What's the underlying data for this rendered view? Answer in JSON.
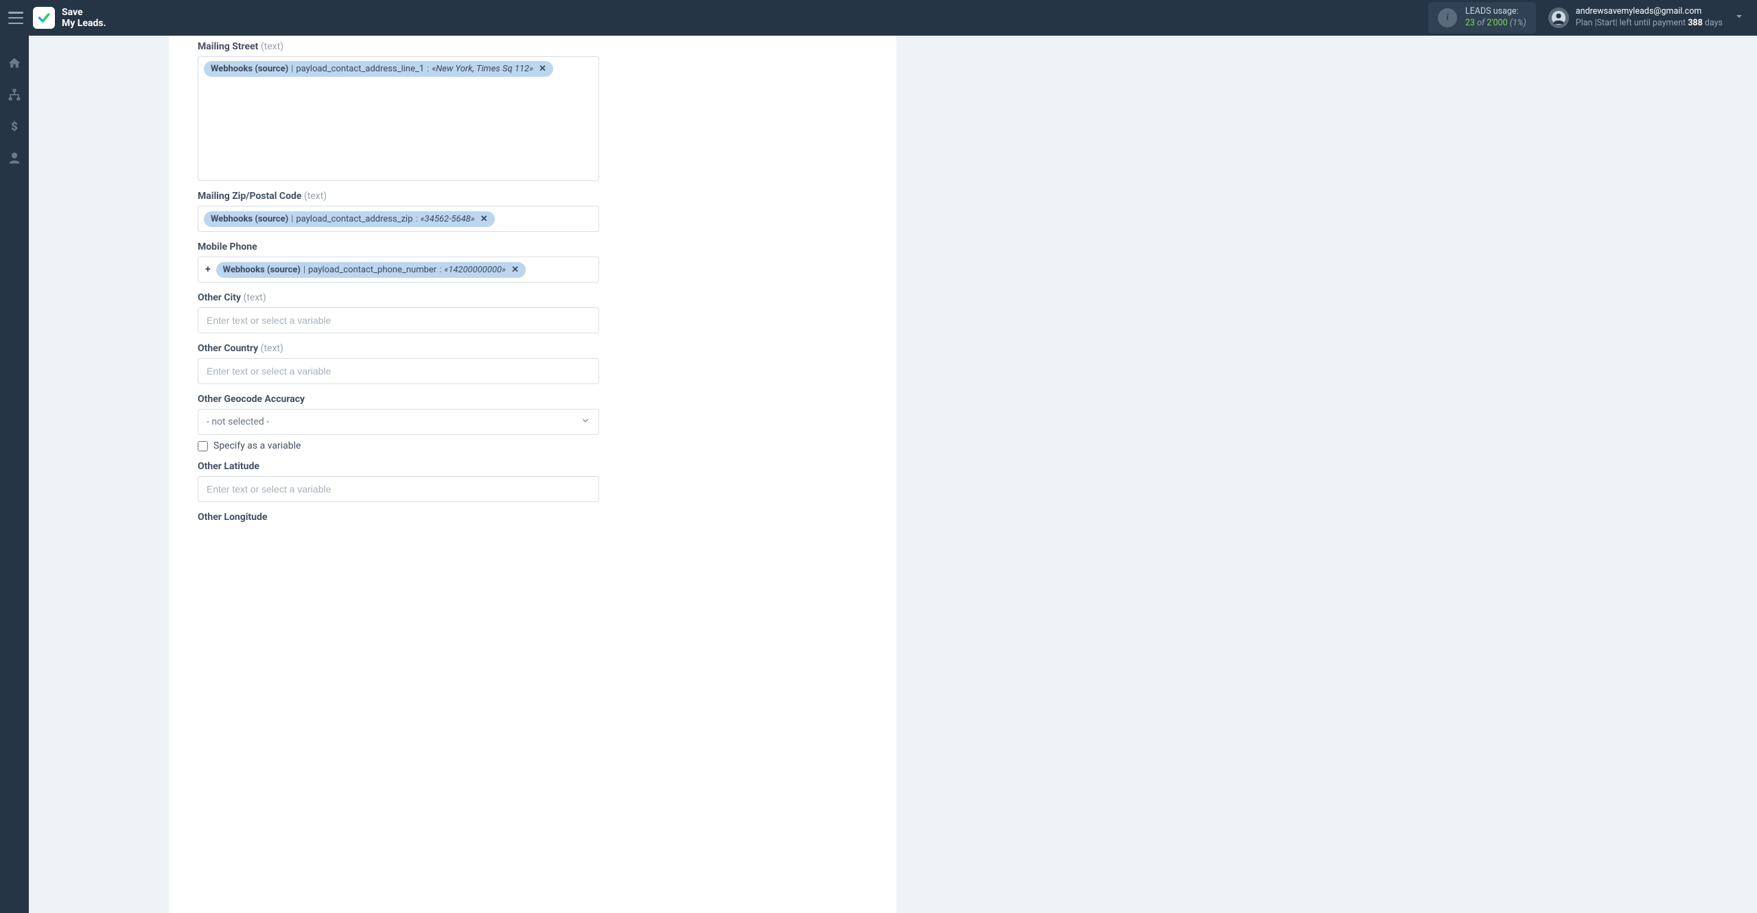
{
  "brand": {
    "line1": "Save",
    "line2": "My Leads."
  },
  "usage": {
    "title": "LEADS usage:",
    "used": "23",
    "of": "of",
    "total": "2'000",
    "pct": "(1%)"
  },
  "user": {
    "email": "andrewsavemyleads@gmail.com",
    "plan_prefix": "Plan ",
    "plan_name": "|Start|",
    "left_text": " left until payment ",
    "days": "388",
    "days_suffix": " days"
  },
  "fields": {
    "mailing_street": {
      "label": "Mailing Street",
      "hint": "(text)",
      "tag": {
        "source": "Webhooks (source)",
        "key": "payload_contact_address_line_1",
        "value": "«New York, Times Sq 112»"
      }
    },
    "mailing_zip": {
      "label": "Mailing Zip/Postal Code",
      "hint": "(text)",
      "tag": {
        "source": "Webhooks (source)",
        "key": "payload_contact_address_zip",
        "value": "«34562-5648»"
      }
    },
    "mobile_phone": {
      "label": "Mobile Phone",
      "prefix": "+",
      "tag": {
        "source": "Webhooks (source)",
        "key": "payload_contact_phone_number",
        "value": "«14200000000»"
      }
    },
    "other_city": {
      "label": "Other City",
      "hint": "(text)",
      "placeholder": "Enter text or select a variable"
    },
    "other_country": {
      "label": "Other Country",
      "hint": "(text)",
      "placeholder": "Enter text or select a variable"
    },
    "other_geocode": {
      "label": "Other Geocode Accuracy",
      "selected": "- not selected -",
      "checkbox_label": "Specify as a variable"
    },
    "other_latitude": {
      "label": "Other Latitude",
      "placeholder": "Enter text or select a variable"
    },
    "other_longitude": {
      "label": "Other Longitude"
    }
  }
}
